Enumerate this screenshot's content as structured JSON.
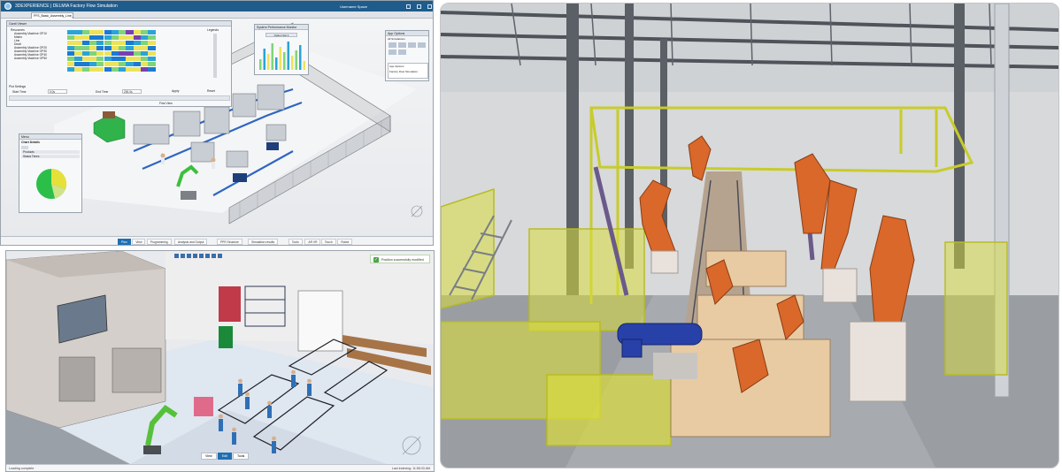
{
  "top_window": {
    "app_title": "3DEXPERIENCE | DELMIA Factory Flow Simulation",
    "user_label": "Username Space",
    "active_tab": "FFS_Basic_Assembly_Line_",
    "resources_panel": {
      "title": "Gantt Viewer",
      "tree_root": "Resources",
      "items": [
        "Assembly Machine OP10",
        "Matrix",
        "Line",
        "Dealt",
        "Assembly Machine OP20",
        "Assembly Machine OP30",
        "Assembly Machine OP40",
        "Assembly Machine OP50"
      ],
      "legends_label": "Legends",
      "plot_settings_label": "Plot Settings",
      "start_time_label": "Start Time",
      "start_time_value": "0.0s",
      "end_time_label": "End Time",
      "end_time_value": "200.0s",
      "apply_label": "Apply",
      "reset_label": "Reset",
      "first_view_label": "First View"
    },
    "sys_perf_panel": {
      "title": "System Performance Monitor",
      "option_label": "Option Set 1"
    },
    "menu_panel": {
      "title": "Menu",
      "chart_details_label": "Chart Details",
      "rows": [
        "Products",
        "Status Times"
      ]
    },
    "app_options_panel": {
      "title": "App Options",
      "section_label": "All Simulations",
      "sim_title": "App Options",
      "sim_value": "Factory Flow Simulation"
    },
    "bottom_tabs": [
      "Plan",
      "View",
      "Programming",
      "Analysis and Output",
      "PPR Structure",
      "Simulation results",
      "Tools",
      "AR VR",
      "Touch",
      "Robot"
    ],
    "active_bottom_tab_index": 0,
    "pie_colors": [
      "#2bbf4a",
      "#e6e13a"
    ],
    "gantt_colors": [
      "#2ba3d6",
      "#7fd47a",
      "#ede35a",
      "#1b7ad1",
      "#7a3fb0"
    ]
  },
  "bottom_window": {
    "toast_text": "Position successfully modified",
    "status_left": "Loading complete",
    "status_right": "Last indexing: 11:58:33 AM",
    "bottom_tabs": [
      "View",
      "Edit",
      "Tools"
    ]
  },
  "right_image": {
    "description_colors": {
      "robot": "#d9682a",
      "railing": "#d8dc3c",
      "steel": "#5a5e66",
      "floor": "#8f9397",
      "blue_robot": "#2841a8",
      "fixture": "#e8cba3"
    }
  }
}
